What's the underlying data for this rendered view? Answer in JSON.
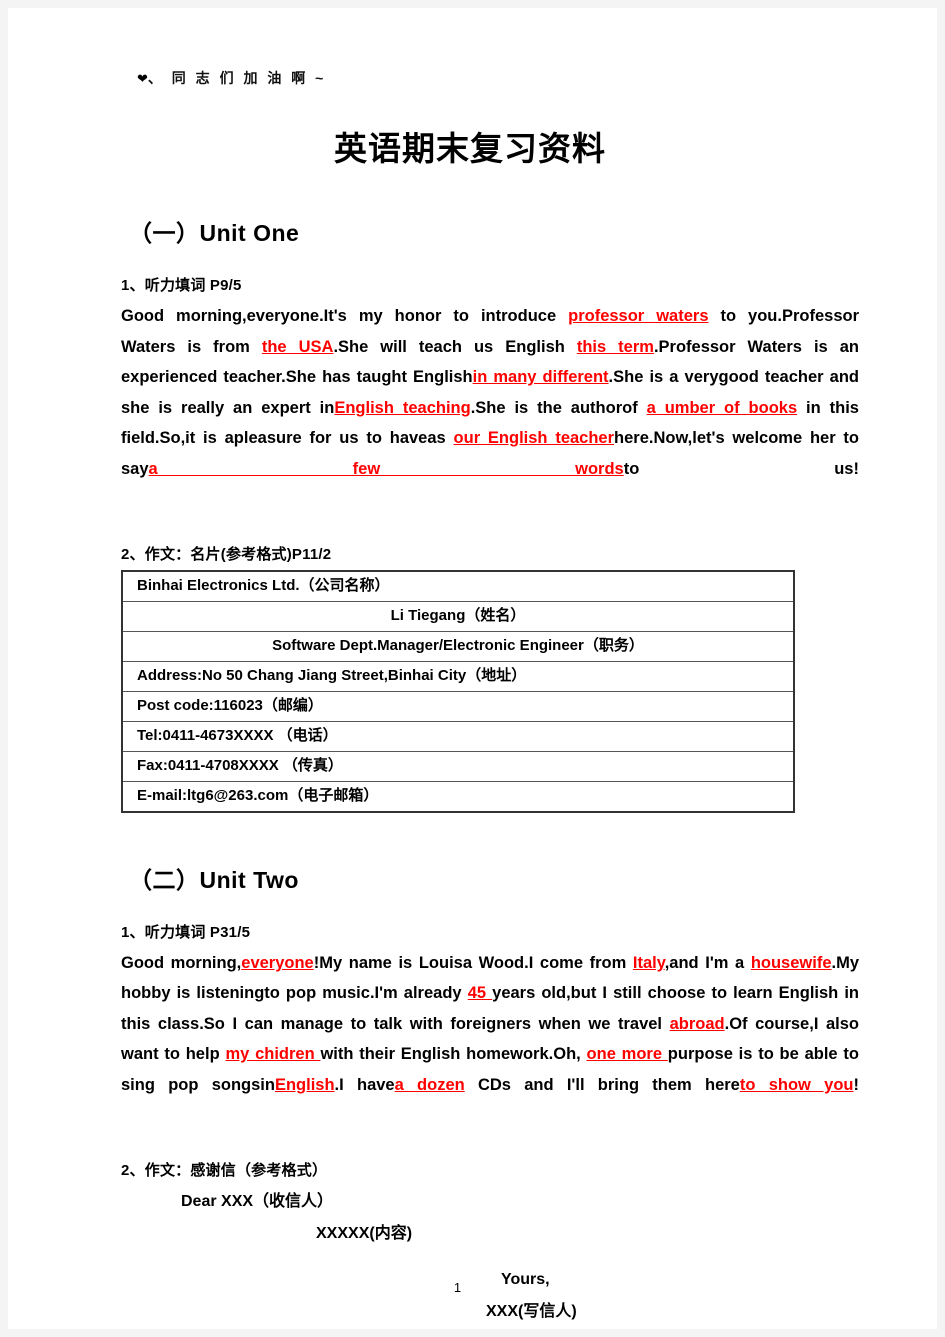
{
  "header_note": {
    "icon": "heart-icon",
    "glyph": "❤",
    "text": "、 同 志 们 加 油 啊 ~"
  },
  "document": {
    "title": "英语期末复习资料",
    "page_number": "1"
  },
  "units": [
    {
      "heading": "（一）Unit One",
      "listening": {
        "label": "1、听力填词 P9/5",
        "segments": [
          {
            "text": "Good morning,everyone.It's my honor to introduce ",
            "fill": false
          },
          {
            "text": "professor waters",
            "fill": true
          },
          {
            "text": " to you.Professor Waters is from ",
            "fill": false
          },
          {
            "text": "the USA",
            "fill": true
          },
          {
            "text": ".She will teach us English ",
            "fill": false
          },
          {
            "text": "this term",
            "fill": true
          },
          {
            "text": ".Professor Waters is an experienced teacher.She has taught English",
            "fill": false
          },
          {
            "text": "in many different",
            "fill": true
          },
          {
            "text": ".She is a verygood teacher and she is really an expert in",
            "fill": false
          },
          {
            "text": "English teaching",
            "fill": true
          },
          {
            "text": ".She is the authorof ",
            "fill": false
          },
          {
            "text": "a umber of books",
            "fill": true
          },
          {
            "text": " in this field.So,it is apleasure for us to haveas ",
            "fill": false
          },
          {
            "text": "our English teacher",
            "fill": true
          },
          {
            "text": "here.Now,let's welcome her to say",
            "fill": false
          },
          {
            "text": "a few words",
            "fill": true
          },
          {
            "text": "to us!",
            "fill": false
          }
        ]
      },
      "writing": {
        "label": "2、作文：名片(参考格式)P11/2",
        "table_rows": [
          {
            "value": "Binhai Electronics Ltd.（公司名称）",
            "align": "left"
          },
          {
            "value": "Li Tiegang（姓名）",
            "align": "center"
          },
          {
            "value": "Software Dept.Manager/Electronic Engineer（职务）",
            "align": "center"
          },
          {
            "value": "Address:No 50 Chang Jiang Street,Binhai City（地址）",
            "align": "left"
          },
          {
            "value": "Post code:116023（邮编）",
            "align": "left"
          },
          {
            "value": "Tel:0411-4673XXXX （电话）",
            "align": "left"
          },
          {
            "value": "Fax:0411-4708XXXX （传真）",
            "align": "left"
          },
          {
            "value": "E-mail:ltg6@263.com（电子邮箱）",
            "align": "left"
          }
        ]
      }
    },
    {
      "heading": "（二）Unit Two",
      "listening": {
        "label": "1、听力填词 P31/5",
        "segments": [
          {
            "text": "Good morning,",
            "fill": false
          },
          {
            "text": "everyone",
            "fill": true
          },
          {
            "text": "!My name is Louisa Wood.I come from ",
            "fill": false
          },
          {
            "text": "Italy",
            "fill": true
          },
          {
            "text": ",and I'm a ",
            "fill": false
          },
          {
            "text": "housewife",
            "fill": true
          },
          {
            "text": ".My hobby is listeningto pop music.I'm already ",
            "fill": false
          },
          {
            "text": "45 ",
            "fill": true
          },
          {
            "text": "years old,but I still choose to learn English in this class.So I can manage to talk with foreigners when we travel ",
            "fill": false
          },
          {
            "text": "abroad",
            "fill": true
          },
          {
            "text": ".Of course,I also want to help ",
            "fill": false
          },
          {
            "text": "my chidren ",
            "fill": true
          },
          {
            "text": "with their English homework.Oh, ",
            "fill": false
          },
          {
            "text": "one more ",
            "fill": true
          },
          {
            "text": "purpose is to be able to sing pop songsin",
            "fill": false
          },
          {
            "text": "English",
            "fill": true
          },
          {
            "text": ".I have",
            "fill": false
          },
          {
            "text": "a dozen",
            "fill": true
          },
          {
            "text": " CDs and I'll bring them here",
            "fill": false
          },
          {
            "text": "to show you",
            "fill": true
          },
          {
            "text": "!",
            "fill": false
          }
        ]
      },
      "writing": {
        "label": "2、作文：感谢信（参考格式）",
        "letter_lines": [
          "Dear XXX（收信人）",
          "XXXXX(内容)",
          "Yours,",
          "XXX(写信人)"
        ]
      }
    }
  ]
}
